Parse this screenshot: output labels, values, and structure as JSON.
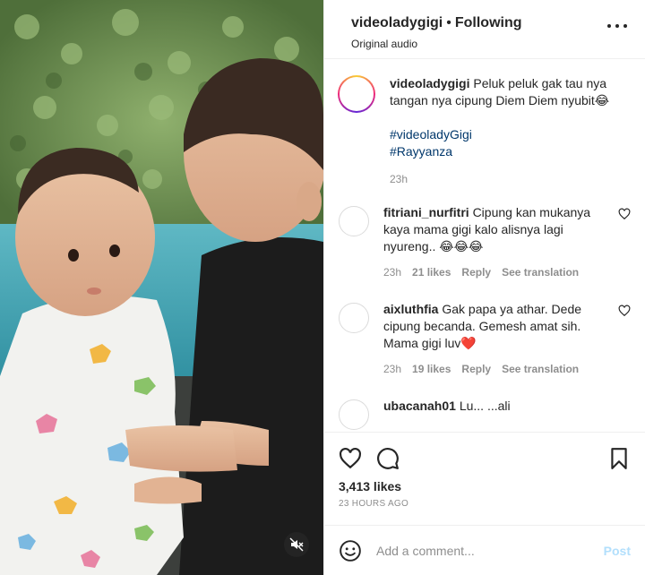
{
  "header": {
    "username": "videoladygigi",
    "separator": "•",
    "following": "Following",
    "audio": "Original audio"
  },
  "caption": {
    "username": "videoladygigi",
    "text": "Peluk peluk gak tau nya tangan nya cipung Diem Diem nyubit😂",
    "tags": [
      "#videoladyGigi",
      "#Rayyanza"
    ],
    "time": "23h"
  },
  "comments": [
    {
      "username": "fitriani_nurfitri",
      "text": "Cipung kan mukanya kaya mama gigi kalo alisnya lagi nyureng.. 😂😂😂",
      "time": "23h",
      "likes": "21 likes",
      "reply": "Reply",
      "translate": "See translation"
    },
    {
      "username": "aixluthfia",
      "text": "Gak papa ya athar. Dede cipung becanda. Gemesh amat sih. Mama gigi luv❤️",
      "time": "23h",
      "likes": "19 likes",
      "reply": "Reply",
      "translate": "See translation"
    }
  ],
  "partial_comment": {
    "username": "ubacanah01",
    "text": "Lu... ...ali"
  },
  "likes_count": "3,413 likes",
  "timestamp": "23 HOURS AGO",
  "add_comment": {
    "placeholder": "Add a comment...",
    "post_label": "Post"
  },
  "icons": {
    "more": "more-options-icon",
    "like": "heart-icon",
    "comment": "comment-icon",
    "save": "bookmark-icon",
    "emoji": "emoji-icon",
    "mute": "speaker-muted-icon"
  },
  "colors": {
    "text": "#262626",
    "muted": "#8e8e8e",
    "hashtag": "#00376b",
    "post_disabled": "#b2dffc",
    "border": "#efefef"
  }
}
